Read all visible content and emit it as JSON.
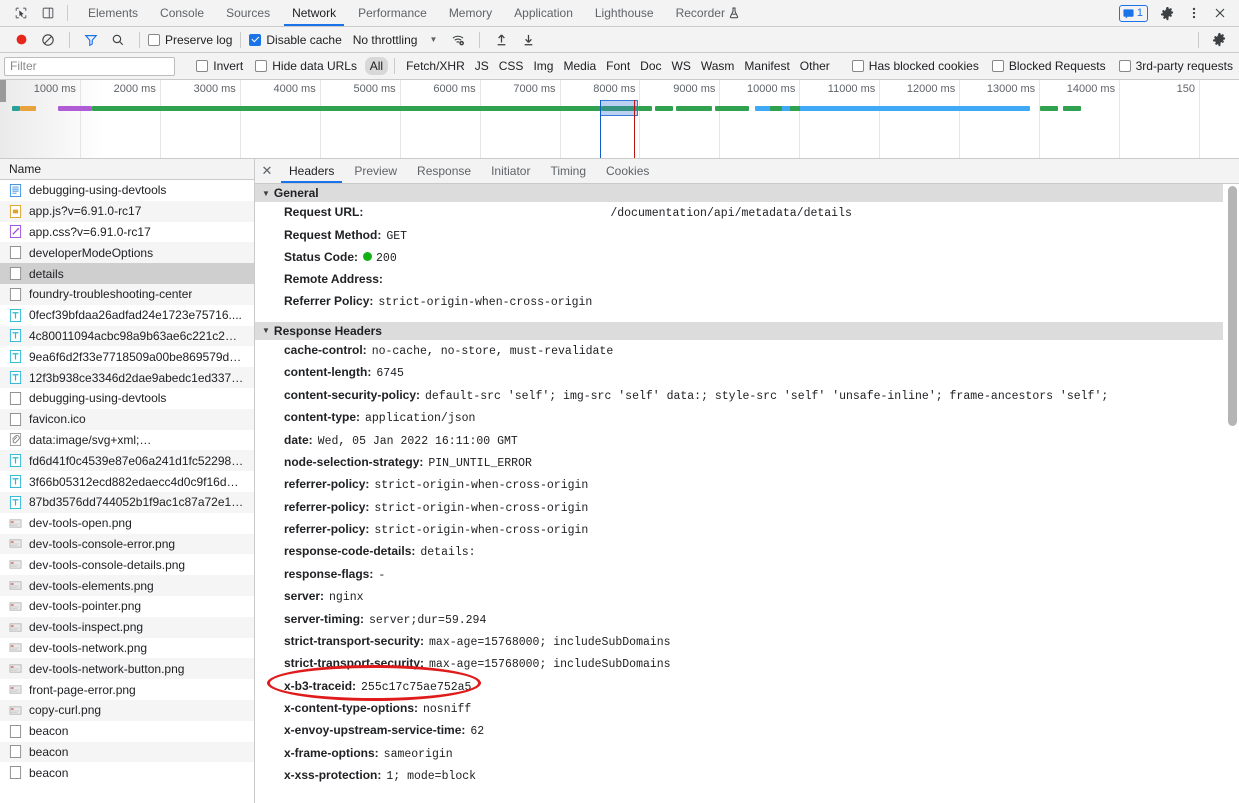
{
  "window": {
    "tabs": [
      {
        "label": "Elements",
        "active": false
      },
      {
        "label": "Console",
        "active": false
      },
      {
        "label": "Sources",
        "active": false
      },
      {
        "label": "Network",
        "active": true
      },
      {
        "label": "Performance",
        "active": false
      },
      {
        "label": "Memory",
        "active": false
      },
      {
        "label": "Application",
        "active": false
      },
      {
        "label": "Lighthouse",
        "active": false
      },
      {
        "label": "Recorder",
        "active": false,
        "icon": "flask-icon"
      }
    ],
    "message_count": "1",
    "icons": [
      "inspect-element-icon",
      "device-toolbar-icon",
      "message-icon",
      "gear-icon",
      "more-vertical-icon",
      "close-icon"
    ]
  },
  "toolbar": {
    "record_label": "record-button",
    "clear_label": "clear-button",
    "filter_label": "filter-button",
    "search_label": "search-button",
    "preserve_log": {
      "label": "Preserve log",
      "checked": false
    },
    "disable_cache": {
      "label": "Disable cache",
      "checked": true
    },
    "throttling": "No throttling",
    "network_conditions_label": "network-conditions-icon",
    "import_label": "import-har-icon",
    "export_label": "export-har-icon",
    "settings_label": "settings-icon"
  },
  "filterbar": {
    "placeholder": "Filter",
    "value": "",
    "invert": {
      "label": "Invert",
      "checked": false
    },
    "hide_data_urls": {
      "label": "Hide data URLs",
      "checked": false
    },
    "types": [
      {
        "label": "All",
        "active": true
      },
      {
        "label": "Fetch/XHR",
        "active": false
      },
      {
        "label": "JS",
        "active": false
      },
      {
        "label": "CSS",
        "active": false
      },
      {
        "label": "Img",
        "active": false
      },
      {
        "label": "Media",
        "active": false
      },
      {
        "label": "Font",
        "active": false
      },
      {
        "label": "Doc",
        "active": false
      },
      {
        "label": "WS",
        "active": false
      },
      {
        "label": "Wasm",
        "active": false
      },
      {
        "label": "Manifest",
        "active": false
      },
      {
        "label": "Other",
        "active": false
      }
    ],
    "has_blocked_cookies": {
      "label": "Has blocked cookies",
      "checked": false
    },
    "blocked_requests": {
      "label": "Blocked Requests",
      "checked": false
    },
    "third_party": {
      "label": "3rd-party requests",
      "checked": false
    }
  },
  "overview": {
    "ticks": [
      "1000 ms",
      "2000 ms",
      "3000 ms",
      "4000 ms",
      "5000 ms",
      "6000 ms",
      "7000 ms",
      "8000 ms",
      "9000 ms",
      "10000 ms",
      "11000 ms",
      "12000 ms",
      "13000 ms",
      "14000 ms",
      "150"
    ],
    "colors": {
      "doc": "#2aa198",
      "script": "#e8a33d",
      "css": "#b05cd6",
      "other": "#30a14e",
      "xhr": "#3fa9f5",
      "load_event": "#b81414",
      "dcl_event": "#0b5fc7"
    }
  },
  "requests": {
    "column_header": "Name",
    "rows": [
      {
        "name": "debugging-using-devtools",
        "icon": "document-icon",
        "selected": false
      },
      {
        "name": "app.js?v=6.91.0-rc17",
        "icon": "script-icon",
        "selected": false
      },
      {
        "name": "app.css?v=6.91.0-rc17",
        "icon": "stylesheet-icon",
        "selected": false
      },
      {
        "name": "developerModeOptions",
        "icon": "generic-icon",
        "selected": false
      },
      {
        "name": "details",
        "icon": "generic-icon",
        "selected": true
      },
      {
        "name": "foundry-troubleshooting-center",
        "icon": "generic-icon",
        "selected": false
      },
      {
        "name": "0fecf39bfdaa26adfad24e1723e75716....",
        "icon": "font-icon",
        "selected": false
      },
      {
        "name": "4c80011094acbc98a9b63ae6c221c2…",
        "icon": "font-icon",
        "selected": false
      },
      {
        "name": "9ea6f6d2f33e7718509a00be869579d…",
        "icon": "font-icon",
        "selected": false
      },
      {
        "name": "12f3b938ce3346d2dae9abedc1ed337…",
        "icon": "font-icon",
        "selected": false
      },
      {
        "name": "debugging-using-devtools",
        "icon": "generic-icon",
        "selected": false
      },
      {
        "name": "favicon.ico",
        "icon": "generic-icon",
        "selected": false
      },
      {
        "name": "data:image/svg+xml;…",
        "icon": "data-url-icon",
        "selected": false
      },
      {
        "name": "fd6d41f0c4539e87e06a241d1fc52298…",
        "icon": "font-icon",
        "selected": false
      },
      {
        "name": "3f66b05312ecd882edaecc4d0c9f16d…",
        "icon": "font-icon",
        "selected": false
      },
      {
        "name": "87bd3576dd744052b1f9ac1c87a72e1…",
        "icon": "font-icon",
        "selected": false
      },
      {
        "name": "dev-tools-open.png",
        "icon": "image-thumb-icon",
        "selected": false
      },
      {
        "name": "dev-tools-console-error.png",
        "icon": "image-thumb-icon",
        "selected": false
      },
      {
        "name": "dev-tools-console-details.png",
        "icon": "image-thumb-icon",
        "selected": false
      },
      {
        "name": "dev-tools-elements.png",
        "icon": "image-thumb-icon",
        "selected": false
      },
      {
        "name": "dev-tools-pointer.png",
        "icon": "image-thumb-icon",
        "selected": false
      },
      {
        "name": "dev-tools-inspect.png",
        "icon": "image-thumb-icon",
        "selected": false
      },
      {
        "name": "dev-tools-network.png",
        "icon": "image-thumb-icon",
        "selected": false
      },
      {
        "name": "dev-tools-network-button.png",
        "icon": "image-thumb-icon",
        "selected": false
      },
      {
        "name": "front-page-error.png",
        "icon": "image-thumb-icon",
        "selected": false
      },
      {
        "name": "copy-curl.png",
        "icon": "image-thumb-icon",
        "selected": false
      },
      {
        "name": "beacon",
        "icon": "generic-icon",
        "selected": false
      },
      {
        "name": "beacon",
        "icon": "generic-icon",
        "selected": false
      },
      {
        "name": "beacon",
        "icon": "generic-icon",
        "selected": false
      }
    ]
  },
  "details": {
    "tabs": [
      {
        "label": "Headers",
        "active": true
      },
      {
        "label": "Preview",
        "active": false
      },
      {
        "label": "Response",
        "active": false
      },
      {
        "label": "Initiator",
        "active": false
      },
      {
        "label": "Timing",
        "active": false
      },
      {
        "label": "Cookies",
        "active": false
      }
    ],
    "general": {
      "title": "General",
      "request_url_label": "Request URL:",
      "request_url_value": "/documentation/api/metadata/details",
      "request_method_label": "Request Method:",
      "request_method_value": "GET",
      "status_code_label": "Status Code:",
      "status_code_value": "200",
      "remote_address_label": "Remote Address:",
      "remote_address_value": "",
      "referrer_policy_label": "Referrer Policy:",
      "referrer_policy_value": "strict-origin-when-cross-origin"
    },
    "response_headers": {
      "title": "Response Headers",
      "items": [
        {
          "name": "cache-control:",
          "value": "no-cache, no-store, must-revalidate"
        },
        {
          "name": "content-length:",
          "value": "6745"
        },
        {
          "name": "content-security-policy:",
          "value": "default-src 'self'; img-src 'self' data:; style-src 'self' 'unsafe-inline'; frame-ancestors 'self';"
        },
        {
          "name": "content-type:",
          "value": "application/json"
        },
        {
          "name": "date:",
          "value": "Wed, 05 Jan 2022 16:11:00 GMT"
        },
        {
          "name": "node-selection-strategy:",
          "value": "PIN_UNTIL_ERROR"
        },
        {
          "name": "referrer-policy:",
          "value": "strict-origin-when-cross-origin"
        },
        {
          "name": "referrer-policy:",
          "value": "strict-origin-when-cross-origin"
        },
        {
          "name": "referrer-policy:",
          "value": "strict-origin-when-cross-origin"
        },
        {
          "name": "response-code-details:",
          "value": "details:"
        },
        {
          "name": "response-flags:",
          "value": "-"
        },
        {
          "name": "server:",
          "value": "nginx"
        },
        {
          "name": "server-timing:",
          "value": "server;dur=59.294"
        },
        {
          "name": "strict-transport-security:",
          "value": "max-age=15768000; includeSubDomains"
        },
        {
          "name": "strict-transport-security:",
          "value": "max-age=15768000; includeSubDomains"
        },
        {
          "name": "x-b3-traceid:",
          "value": "255c17c75ae752a5",
          "annotated": true
        },
        {
          "name": "x-content-type-options:",
          "value": "nosniff"
        },
        {
          "name": "x-envoy-upstream-service-time:",
          "value": "62"
        },
        {
          "name": "x-frame-options:",
          "value": "sameorigin"
        },
        {
          "name": "x-xss-protection:",
          "value": "1; mode=block"
        }
      ]
    },
    "annotation_color": "#e01b1b"
  }
}
